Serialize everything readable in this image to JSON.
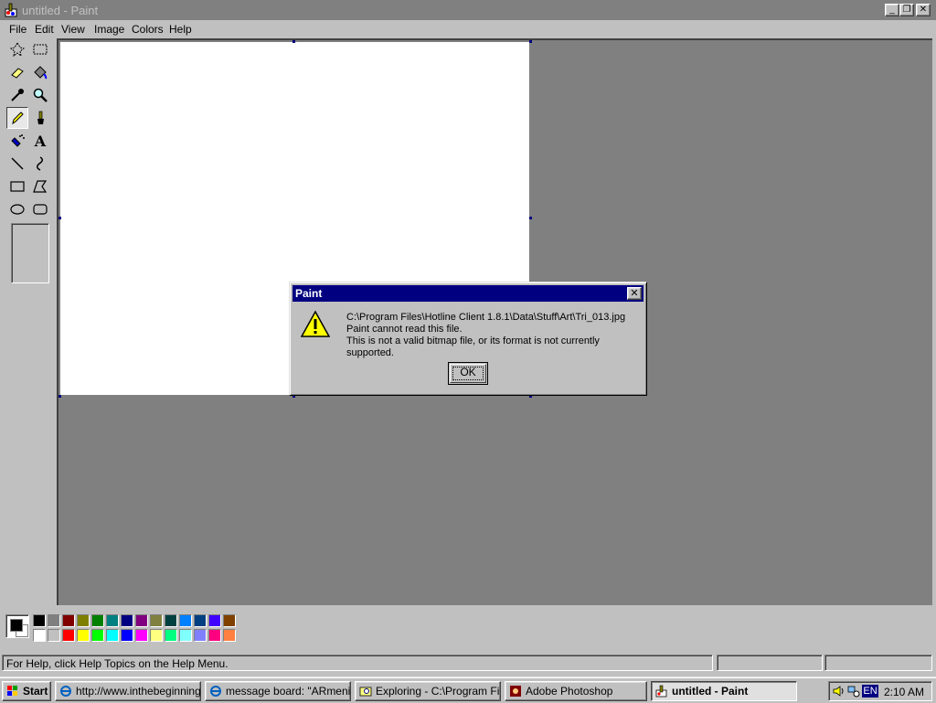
{
  "window": {
    "title": "untitled - Paint",
    "controls": {
      "minimize": "_",
      "restore": "❐",
      "close": "✕"
    }
  },
  "menu": [
    "File",
    "Edit",
    "View",
    "Image",
    "Colors",
    "Help"
  ],
  "tools": [
    "free-form-select",
    "select",
    "eraser",
    "fill-with-color",
    "pick-color",
    "magnifier",
    "pencil",
    "brush",
    "airbrush",
    "text",
    "line",
    "curve",
    "rectangle",
    "polygon",
    "ellipse",
    "rounded-rectangle"
  ],
  "active_tool": "pencil",
  "text_tool_glyph": "A",
  "palette": {
    "foreground": "#000000",
    "background": "#ffffff",
    "top": [
      "#000000",
      "#808080",
      "#800000",
      "#808000",
      "#008000",
      "#008080",
      "#000080",
      "#800080",
      "#808040",
      "#004040",
      "#0080ff",
      "#004080",
      "#4000ff",
      "#804000"
    ],
    "bottom": [
      "#ffffff",
      "#c0c0c0",
      "#ff0000",
      "#ffff00",
      "#00ff00",
      "#00ffff",
      "#0000ff",
      "#ff00ff",
      "#ffff80",
      "#00ff80",
      "#80ffff",
      "#8080ff",
      "#ff0080",
      "#ff8040"
    ]
  },
  "status": {
    "help_text": "For Help, click Help Topics on the Help Menu."
  },
  "dialog": {
    "title": "Paint",
    "close": "✕",
    "lines": [
      "C:\\Program Files\\Hotline Client 1.8.1\\Data\\Stuff\\Art\\Tri_013.jpg",
      "Paint cannot read this file.",
      "This is not a valid bitmap file, or its format is not currently supported."
    ],
    "ok_label": "OK"
  },
  "taskbar": {
    "start_label": "Start",
    "tasks": [
      {
        "label": "http://www.inthebeginning...",
        "icon": "ie-icon"
      },
      {
        "label": "message board: \"ARmenia...",
        "icon": "ie-icon"
      },
      {
        "label": "Exploring - C:\\Program File...",
        "icon": "explorer-icon"
      },
      {
        "label": "Adobe Photoshop",
        "icon": "photoshop-icon"
      },
      {
        "label": "untitled - Paint",
        "icon": "paint-icon",
        "active": true
      }
    ],
    "tray": {
      "language": "EN",
      "clock": "2:10 AM"
    }
  }
}
